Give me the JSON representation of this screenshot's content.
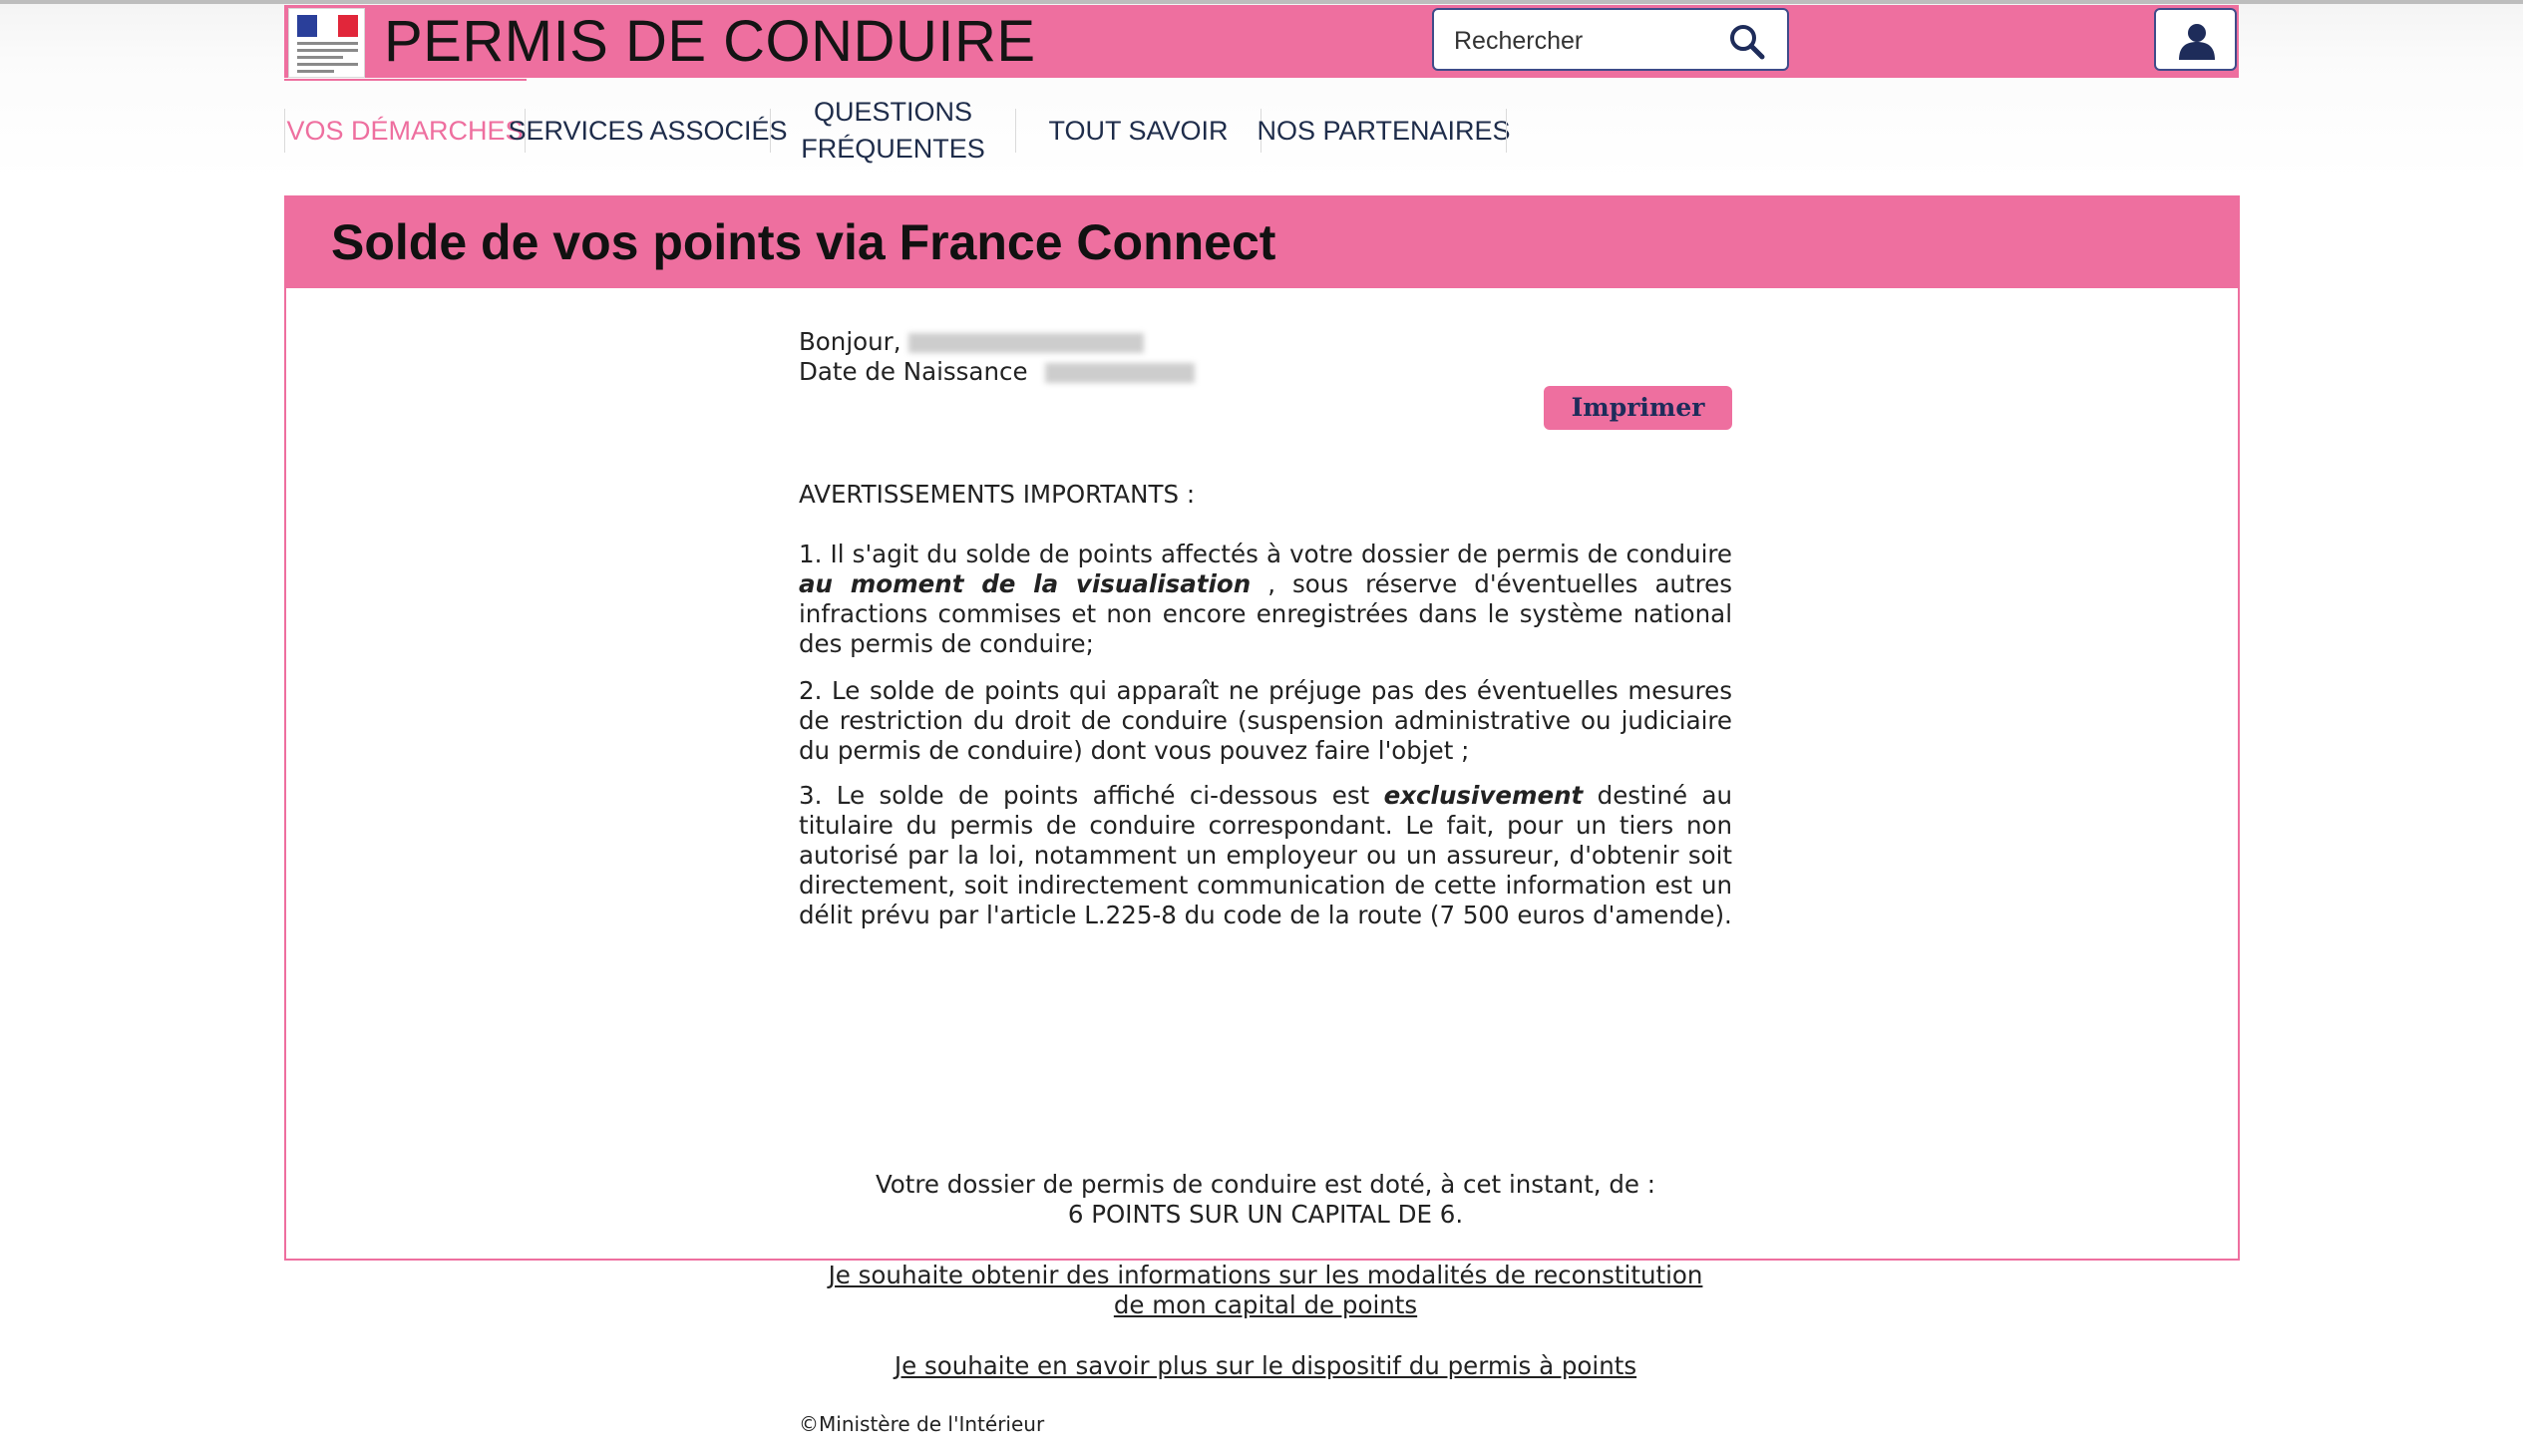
{
  "header": {
    "site_title": "PERMIS DE CONDUIRE",
    "search_placeholder": "Rechercher",
    "logo_icon": "marianne-logo-icon",
    "search_icon": "search-icon",
    "user_icon": "user-icon"
  },
  "nav": {
    "items": [
      {
        "label": "VOS DÉMARCHES",
        "active": true
      },
      {
        "label": "SERVICES ASSOCIÉS",
        "active": false
      },
      {
        "label": "QUESTIONS FRÉQUENTES",
        "active": false
      },
      {
        "label": "TOUT SAVOIR",
        "active": false
      },
      {
        "label": "NOS PARTENAIRES",
        "active": false
      }
    ]
  },
  "panel": {
    "title": "Solde de vos points via France Connect",
    "greeting_label": "Bonjour,",
    "birthdate_label": "Date de Naissance",
    "print_label": "Imprimer",
    "warnings_title": "AVERTISSEMENTS IMPORTANTS :",
    "para1_a": "1. Il s'agit du solde de points affectés à votre dossier de permis de conduire",
    "para1_em": "au moment de la visualisation",
    "para1_b": ", sous réserve d'éventuelles autres infractions commises et non encore enregistrées dans le système national des permis de conduire;",
    "para2": "2. Le solde de points qui apparaît ne préjuge pas des éventuelles mesures de restriction du droit de conduire (suspension administrative ou judiciaire du permis de conduire) dont vous pouvez faire l'objet ;",
    "para3_a": "3. Le solde de points affiché ci-dessous est",
    "para3_em": "exclusivement",
    "para3_b": "destiné au titulaire du permis de conduire correspondant. Le fait, pour un tiers non autorisé par la loi, notamment un employeur ou un assureur, d'obtenir soit directement, soit indirectement communication de cette information est un délit prévu par l'article L.225-8 du code de la route (7 500 euros d'amende).",
    "points_intro": "Votre dossier de permis de conduire est doté, à cet instant, de :",
    "points_value": "6 POINTS SUR UN CAPITAL DE 6.",
    "link_reconstitution": "Je souhaite obtenir des informations sur les modalités de reconstitution de mon capital de points",
    "link_dispositif": "Je souhaite en savoir plus sur le dispositif du permis à points",
    "copyright": "©Ministère de l'Intérieur"
  },
  "colors": {
    "brand_pink": "#ee6f9f",
    "navy": "#1e2c4a",
    "border_blue": "#3f4c8a"
  }
}
